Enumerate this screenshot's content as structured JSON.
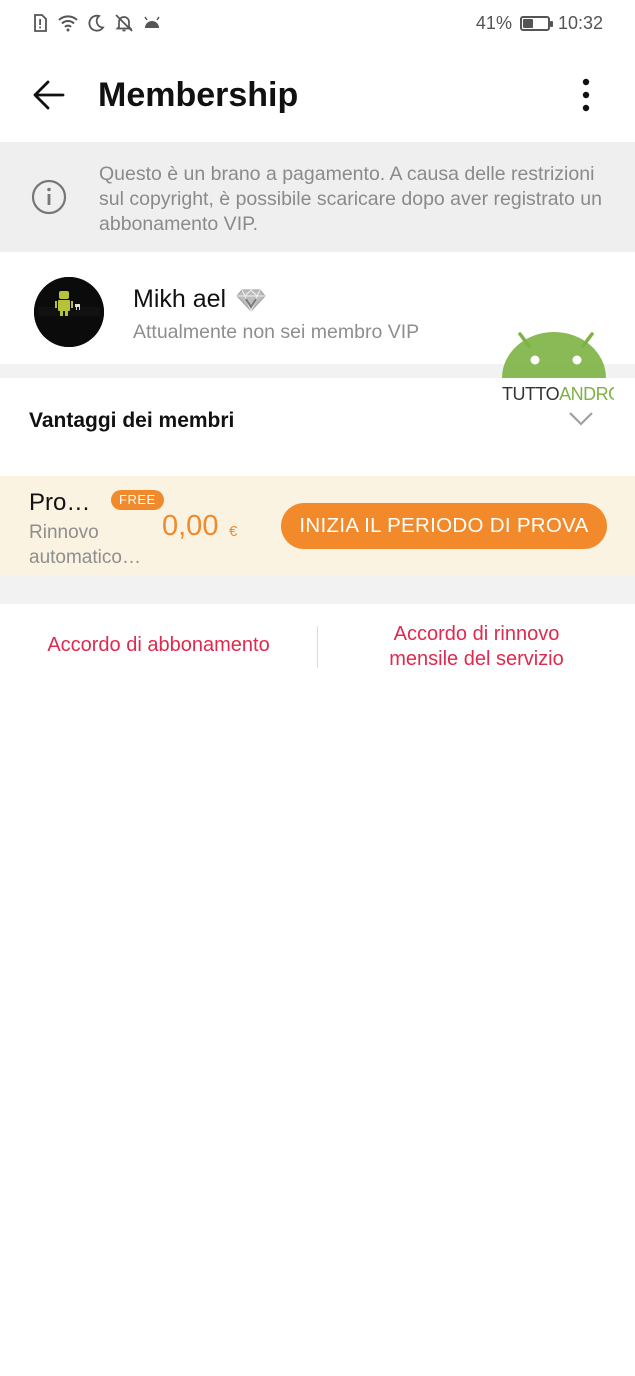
{
  "status_bar": {
    "battery_percent": "41%",
    "battery_level": 0.41,
    "time": "10:32",
    "icons": [
      "sim-alert-icon",
      "wifi-icon",
      "moon-icon",
      "bell-off-icon",
      "android-icon"
    ]
  },
  "app_bar": {
    "title": "Membership",
    "back_icon": "arrow-left-icon",
    "more_icon": "more-vertical-icon"
  },
  "notice": {
    "icon": "info-icon",
    "text": "Questo è un brano a pagamento. A causa delle restrizioni sul copyright, è possibile scaricare dopo aver registrato un abbonamento VIP."
  },
  "profile": {
    "name": "Mikh ael",
    "badge_icon": "diamond-icon",
    "vip_status": "Attualmente non sei membro VIP"
  },
  "watermark": {
    "text_part1": "TUTTO",
    "text_part2": "ANDROID"
  },
  "benefits": {
    "label": "Vantaggi dei membri",
    "icon": "chevron-down-icon"
  },
  "plan": {
    "name": "Pro…",
    "badge": "FREE",
    "renew_text": "Rinnovo automatico…",
    "price": "0,00",
    "currency": "€",
    "button_label": "INIZIA IL PERIODO DI PROVA"
  },
  "agreements": {
    "left": "Accordo di abbonamento",
    "right_line1": "Accordo di rinnovo",
    "right_line2": "mensile del servizio"
  },
  "colors": {
    "accent_orange": "#f28a2c",
    "link_red": "#e0294e",
    "plan_background": "#fbf3e1",
    "watermark_green": "#7cb342"
  }
}
